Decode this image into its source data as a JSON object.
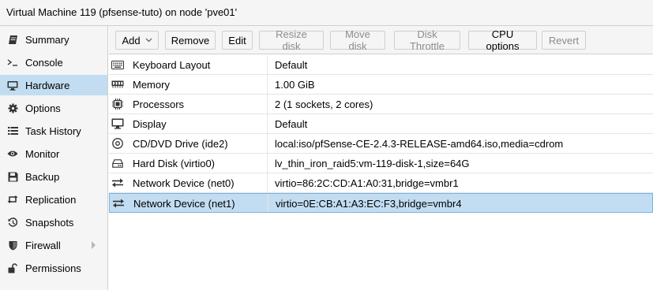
{
  "window": {
    "title": "Virtual Machine 119 (pfsense-tuto) on node 'pve01'"
  },
  "sidebar": {
    "items": [
      {
        "label": "Summary",
        "icon": "book-icon"
      },
      {
        "label": "Console",
        "icon": "terminal-icon"
      },
      {
        "label": "Hardware",
        "icon": "monitor-icon",
        "active": true
      },
      {
        "label": "Options",
        "icon": "gear-icon"
      },
      {
        "label": "Task History",
        "icon": "list-icon"
      },
      {
        "label": "Monitor",
        "icon": "eye-icon"
      },
      {
        "label": "Backup",
        "icon": "floppy-icon"
      },
      {
        "label": "Replication",
        "icon": "retweet-icon"
      },
      {
        "label": "Snapshots",
        "icon": "history-icon"
      },
      {
        "label": "Firewall",
        "icon": "shield-icon",
        "has_submenu": true
      },
      {
        "label": "Permissions",
        "icon": "unlock-icon"
      }
    ]
  },
  "toolbar": {
    "add_label": "Add",
    "remove_label": "Remove",
    "edit_label": "Edit",
    "resize_label": "Resize disk",
    "move_label": "Move disk",
    "throttle_label": "Disk Throttle",
    "cpu_label": "CPU options",
    "revert_label": "Revert"
  },
  "hardware": {
    "rows": [
      {
        "name": "Keyboard Layout",
        "value": "Default",
        "icon": "keyboard-icon"
      },
      {
        "name": "Memory",
        "value": "1.00 GiB",
        "icon": "memory-icon"
      },
      {
        "name": "Processors",
        "value": "2 (1 sockets, 2 cores)",
        "icon": "cpu-icon"
      },
      {
        "name": "Display",
        "value": "Default",
        "icon": "desktop-icon"
      },
      {
        "name": "CD/DVD Drive (ide2)",
        "value": "local:iso/pfSense-CE-2.4.3-RELEASE-amd64.iso,media=cdrom",
        "icon": "cdrom-icon"
      },
      {
        "name": "Hard Disk (virtio0)",
        "value": "lv_thin_iron_raid5:vm-119-disk-1,size=64G",
        "icon": "hdd-icon"
      },
      {
        "name": "Network Device (net0)",
        "value": "virtio=86:2C:CD:A1:A0:31,bridge=vmbr1",
        "icon": "exchange-icon"
      },
      {
        "name": "Network Device (net1)",
        "value": "virtio=0E:CB:A1:A3:EC:F3,bridge=vmbr4",
        "icon": "exchange-icon",
        "selected": true
      }
    ]
  }
}
